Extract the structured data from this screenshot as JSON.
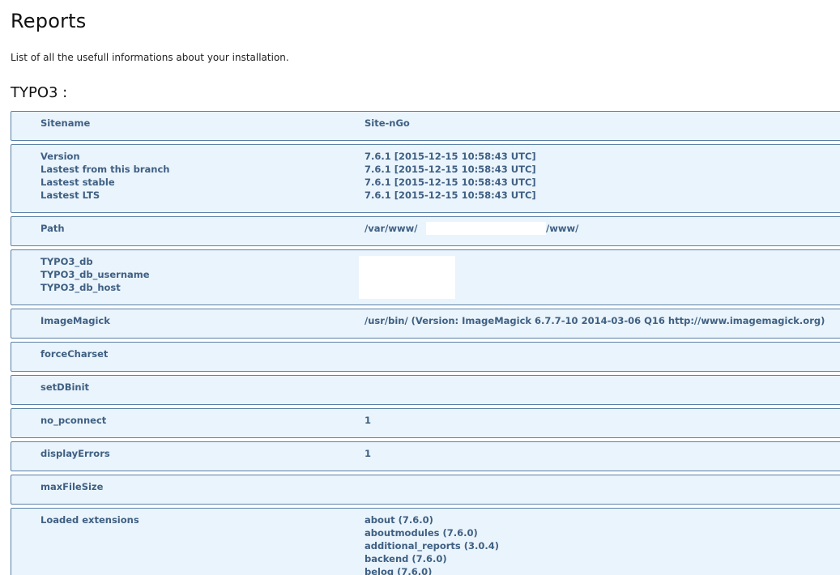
{
  "header": {
    "title": "Reports",
    "description": "List of all the usefull informations about your installation."
  },
  "section": {
    "title": "TYPO3 :"
  },
  "blocks": {
    "sitename": {
      "label": "Sitename",
      "value": "Site-nGo"
    },
    "version": {
      "rows": [
        {
          "label": "Version",
          "value": "7.6.1 [2015-12-15 10:58:43 UTC]"
        },
        {
          "label": "Lastest from this branch",
          "value": "7.6.1 [2015-12-15 10:58:43 UTC]"
        },
        {
          "label": "Lastest stable",
          "value": "7.6.1 [2015-12-15 10:58:43 UTC]"
        },
        {
          "label": "Lastest LTS",
          "value": "7.6.1 [2015-12-15 10:58:43 UTC]"
        }
      ]
    },
    "path": {
      "label": "Path",
      "value_prefix": "/var/www/",
      "value_suffix": "/www/"
    },
    "db": {
      "rows": [
        {
          "label": "TYPO3_db"
        },
        {
          "label": "TYPO3_db_username"
        },
        {
          "label": "TYPO3_db_host"
        }
      ]
    },
    "imagemagick": {
      "label": "ImageMagick",
      "value": "/usr/bin/ (Version: ImageMagick 6.7.7-10 2014-03-06 Q16 http://www.imagemagick.org)"
    },
    "force_charset": {
      "label": "forceCharset",
      "value": ""
    },
    "set_db_init": {
      "label": "setDBinit",
      "value": ""
    },
    "no_pconnect": {
      "label": "no_pconnect",
      "value": "1"
    },
    "display_errors": {
      "label": "displayErrors",
      "value": "1"
    },
    "max_file_size": {
      "label": "maxFileSize",
      "value": ""
    },
    "loaded_extensions": {
      "label": "Loaded extensions",
      "items": [
        "about (7.6.0)",
        "aboutmodules (7.6.0)",
        "additional_reports (3.0.4)",
        "backend (7.6.0)",
        "belog (7.6.0)"
      ]
    }
  }
}
